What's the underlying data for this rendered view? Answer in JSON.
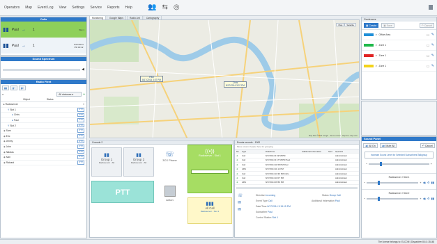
{
  "menu": [
    "Operators",
    "Map",
    "Event Log",
    "View",
    "Settings",
    "Service",
    "Reports",
    "Help"
  ],
  "calls": {
    "title": "Calls",
    "rows": [
      {
        "caller": "Paul",
        "callee": "Paul",
        "number": "1",
        "time": "",
        "slot": "Slot 1"
      },
      {
        "caller": "Paul",
        "callee": "",
        "number": "1",
        "time": "8/17/2014 PM 00:12",
        "slot": "Slot 1"
      }
    ]
  },
  "spectrum": {
    "title": "Sound Spectrum"
  },
  "radiofleet": {
    "title": "Radio Fleet",
    "filter": "All statuses",
    "col_object": "Object",
    "col_status": "Status",
    "items": [
      {
        "name": "Radioserver",
        "indent": 0,
        "ptt": false
      },
      {
        "name": "Slot 1",
        "indent": 1,
        "ptt": true
      },
      {
        "name": "Chris",
        "indent": 2,
        "ptt": true
      },
      {
        "name": "Paul",
        "indent": 2,
        "ptt": true
      },
      {
        "name": "Slot 2",
        "indent": 1,
        "ptt": true
      },
      {
        "name": "Sam",
        "indent": 0,
        "ptt": true
      },
      {
        "name": "Eric",
        "indent": 0,
        "ptt": true
      },
      {
        "name": "Jimmy",
        "indent": 0,
        "ptt": true
      },
      {
        "name": "John",
        "indent": 0,
        "ptt": true
      },
      {
        "name": "Nikolas",
        "indent": 0,
        "ptt": true
      },
      {
        "name": "Ivan",
        "indent": 0,
        "ptt": true
      },
      {
        "name": "Richard",
        "indent": 0,
        "ptt": true
      }
    ]
  },
  "map": {
    "tabs": [
      "Monitoring",
      "Google Maps",
      "Radio Ant",
      "Cartography"
    ],
    "type_buttons": [
      "Map",
      "Satellite"
    ],
    "markers": [
      {
        "name": "Paul",
        "time": "8/17/2014 3:57 PM"
      },
      {
        "name": "Chris",
        "time": "8/17/2014 3:07 PM"
      }
    ],
    "footer": "Map data ©2014 Google · Terms of Use · Report a map error"
  },
  "console": {
    "title": "Console 2",
    "group1": {
      "name": "Group 1",
      "sub": "Radioserver - Slt"
    },
    "group2": {
      "name": "Group 2",
      "sub": "Radioserver - Slt"
    },
    "ptt": "PTT",
    "phone": "3CX Phone",
    "anton": "Anton",
    "radio_slot": "Radioserver - Slot 1",
    "all_call": "All Call",
    "all_call_sub": "Radioserver - Slot 1"
  },
  "events": {
    "title": "Events records - 1000",
    "group_hint": "Move column header here for grouping",
    "columns": [
      "No",
      "Type",
      "Date/Time",
      "Additional Information",
      "Sent",
      "Operator"
    ],
    "rows": [
      {
        "type": "Call",
        "time": "8/17/2014 3:19:58 PM",
        "op": "Administrator"
      },
      {
        "type": "Call",
        "time": "8/17/2014 3:17:58 PM  Paul",
        "op": "Administrator"
      },
      {
        "type": "Call",
        "time": "8/17/2014 11:58 PM  Paul",
        "op": "Administrator"
      },
      {
        "type": "ARS",
        "time": "8/17/2014 11:12 PM",
        "op": "Administrator"
      },
      {
        "type": "Call",
        "time": "8/17/2014 10:36 PM  Chris",
        "op": "Administrator"
      },
      {
        "type": "Call",
        "time": "8/17/2014 10:07 PM",
        "op": "Administrator"
      },
      {
        "type": "ARS",
        "time": "8/17/2014 09:59 PM",
        "op": "Administrator"
      }
    ],
    "detail": {
      "direction_label": "Direction",
      "direction": "Incoming",
      "status_label": "Status",
      "status": "Group Call",
      "event_type_label": "Event Type",
      "event_type": "Call",
      "additional_label": "Additional Information",
      "additional": "Paul",
      "datetime_label": "Date/Time",
      "datetime": "8/17/2014 3:15:15 PM",
      "subscriber_label": "Subscriber",
      "subscriber": "Paul",
      "station_label": "Control Station",
      "station": "Slot 1"
    }
  },
  "geofences": {
    "title": "Geofences",
    "buttons": [
      "Create",
      "Save",
      "Cancel"
    ],
    "items": [
      {
        "name": "Office Area",
        "color": "#1f8fd8"
      },
      {
        "name": "Zone 1",
        "color": "#1fb84a"
      },
      {
        "name": "Zone 1",
        "color": "#e02424"
      },
      {
        "name": "Zone 1",
        "color": "#f2d21b"
      }
    ]
  },
  "sound": {
    "title": "Sound Panel",
    "buttons": [
      "All On",
      "Mute All",
      "Cancel"
    ],
    "increase": "Increase Sound Level for Selected Subscribers/Talkgroup",
    "channels": [
      "Radioserver / Slot 1",
      "Radioserver / Slot 2"
    ]
  },
  "status": {
    "license": "The license belongs to: ELCOM",
    "version": "Dispatcher 8.6.0.15148"
  }
}
